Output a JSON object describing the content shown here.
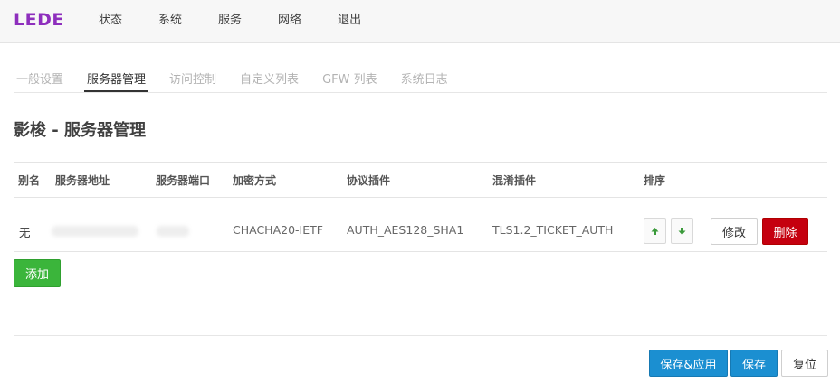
{
  "brand": "LEDE",
  "top_nav": [
    "状态",
    "系统",
    "服务",
    "网络",
    "退出"
  ],
  "tabs": [
    {
      "label": "一般设置",
      "active": false
    },
    {
      "label": "服务器管理",
      "active": true
    },
    {
      "label": "访问控制",
      "active": false
    },
    {
      "label": "自定义列表",
      "active": false
    },
    {
      "label": "GFW 列表",
      "active": false
    },
    {
      "label": "系统日志",
      "active": false
    }
  ],
  "section_title": "影梭 - 服务器管理",
  "table": {
    "headers": [
      "别名",
      "服务器地址",
      "服务器端口",
      "加密方式",
      "协议插件",
      "混淆插件",
      "排序"
    ],
    "rows": [
      {
        "alias": "无",
        "address": "",
        "port": "",
        "encryption": "CHACHA20-IETF",
        "protocol": "AUTH_AES128_SHA1",
        "obfs": "TLS1.2_TICKET_AUTH"
      }
    ]
  },
  "icons": {
    "move_up": "arrow-up-icon",
    "move_down": "arrow-down-icon"
  },
  "buttons": {
    "edit": "修改",
    "delete": "删除",
    "add": "添加",
    "save_apply": "保存&应用",
    "save": "保存",
    "reset": "复位"
  },
  "colors": {
    "brand": "#8e2fbd",
    "primary": "#1b8fd1",
    "danger": "#c5000f",
    "success": "#3bb53b",
    "arrow": "#3a9a3a"
  }
}
